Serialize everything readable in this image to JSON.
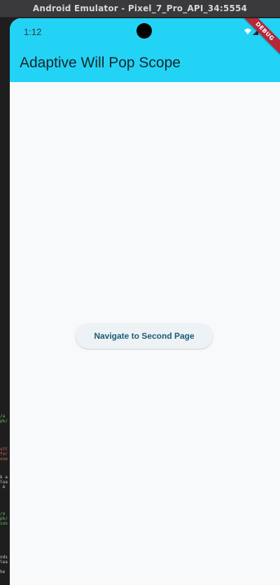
{
  "window": {
    "title": "Android Emulator - Pixel_7_Pro_API_34:5554"
  },
  "status_bar": {
    "time": "1:12",
    "icons": [
      "wifi-icon",
      "signal-icon",
      "battery-icon"
    ]
  },
  "debug_banner": {
    "label": "DEBUG"
  },
  "app_bar": {
    "title": "Adaptive Will Pop Scope",
    "color": "#22d3f5"
  },
  "main": {
    "button_label": "Navigate to Second Page",
    "background": "#f7f9fb"
  }
}
